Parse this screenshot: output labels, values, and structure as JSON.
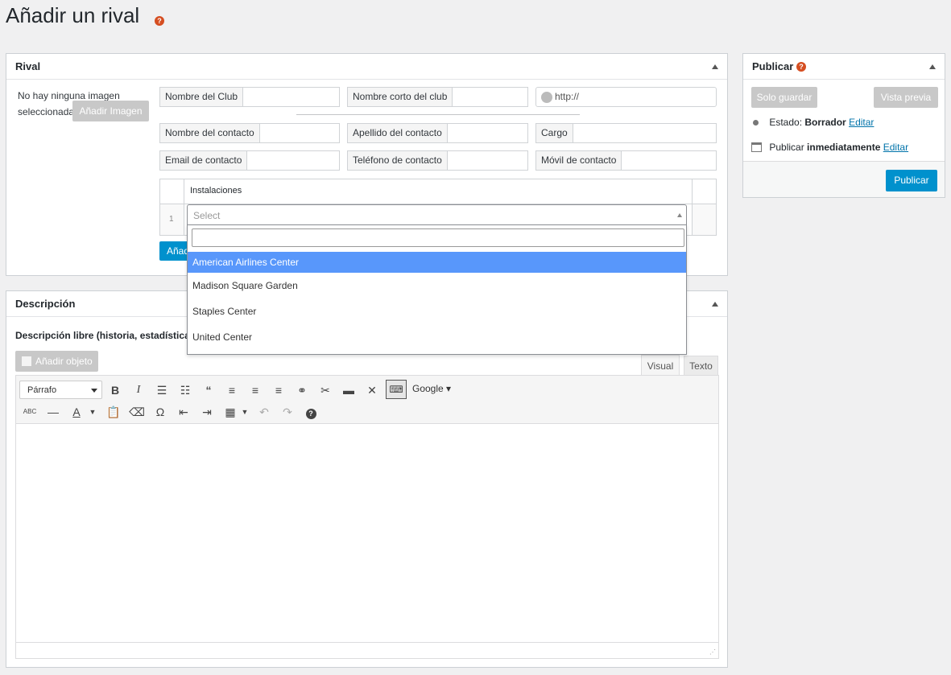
{
  "page": {
    "title": "Añadir un rival",
    "help_glyph": "?"
  },
  "rival_box": {
    "title": "Rival",
    "image_text_line1": "No hay ninguna imagen",
    "image_text_line2": "seleccionada",
    "add_image_button": "Añadir Imagen",
    "fields": {
      "club_name": "Nombre del Club",
      "club_short": "Nombre corto del club",
      "url_placeholder": "http://",
      "contact_name": "Nombre del contacto",
      "contact_surname": "Apellido del contacto",
      "role": "Cargo",
      "contact_email": "Email de contacto",
      "contact_phone": "Teléfono de contacto",
      "contact_mobile": "Móvil de contacto"
    },
    "table": {
      "header": "Instalaciones",
      "row_number": "1",
      "select_placeholder": "Select"
    },
    "add_button_partial": "Añad"
  },
  "dropdown": {
    "options": [
      "American Airlines Center",
      "Madison Square Garden",
      "Staples Center",
      "United Center"
    ],
    "selected_index": 0
  },
  "description_box": {
    "title": "Descripción",
    "subtitle": "Descripción libre (historia, estadísticas,...)",
    "add_object_button": "Añadir objeto",
    "tabs": {
      "visual": "Visual",
      "text": "Texto"
    },
    "format_select": "Párrafo",
    "google_button": "Google"
  },
  "publish_box": {
    "title": "Publicar",
    "save_button": "Solo guardar",
    "preview_button": "Vista previa",
    "status_label": "Estado:",
    "status_value": "Borrador",
    "status_edit": "Editar",
    "publish_label": "Publicar",
    "publish_value": "inmediatamente",
    "publish_edit": "Editar",
    "publish_button": "Publicar"
  },
  "colors": {
    "primary_blue": "#0091cd",
    "selected_option": "#5897fb",
    "disabled_grey": "#c8c8c8",
    "help_orange": "#d54e21"
  }
}
